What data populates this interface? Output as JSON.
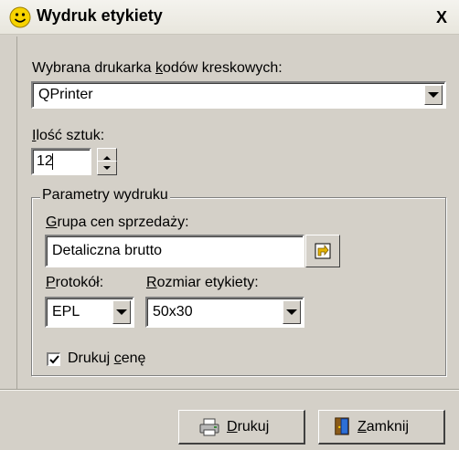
{
  "window": {
    "title": "Wydruk etykiety",
    "close_label": "X"
  },
  "printer": {
    "label_pre": "Wybrana drukarka ",
    "label_u": "k",
    "label_post": "odów kreskowych:",
    "value": "QPrinter"
  },
  "quantity": {
    "label_u": "I",
    "label_post": "lość sztuk:",
    "value": "12"
  },
  "print_params": {
    "title": "Parametry wydruku",
    "price_group_u": "G",
    "price_group_post": "rupa cen sprzedaży:",
    "price_group_value": "Detaliczna brutto",
    "protocol_u": "P",
    "protocol_post": "rotokół:",
    "protocol_value": "EPL",
    "size_u": "R",
    "size_post": "ozmiar etykiety:",
    "size_value": "50x30",
    "print_price_pre": "Drukuj ",
    "print_price_u": "c",
    "print_price_post": "enę",
    "print_price_checked": true
  },
  "buttons": {
    "print_u": "D",
    "print_post": "rukuj",
    "close_u": "Z",
    "close_post": "amknij"
  }
}
